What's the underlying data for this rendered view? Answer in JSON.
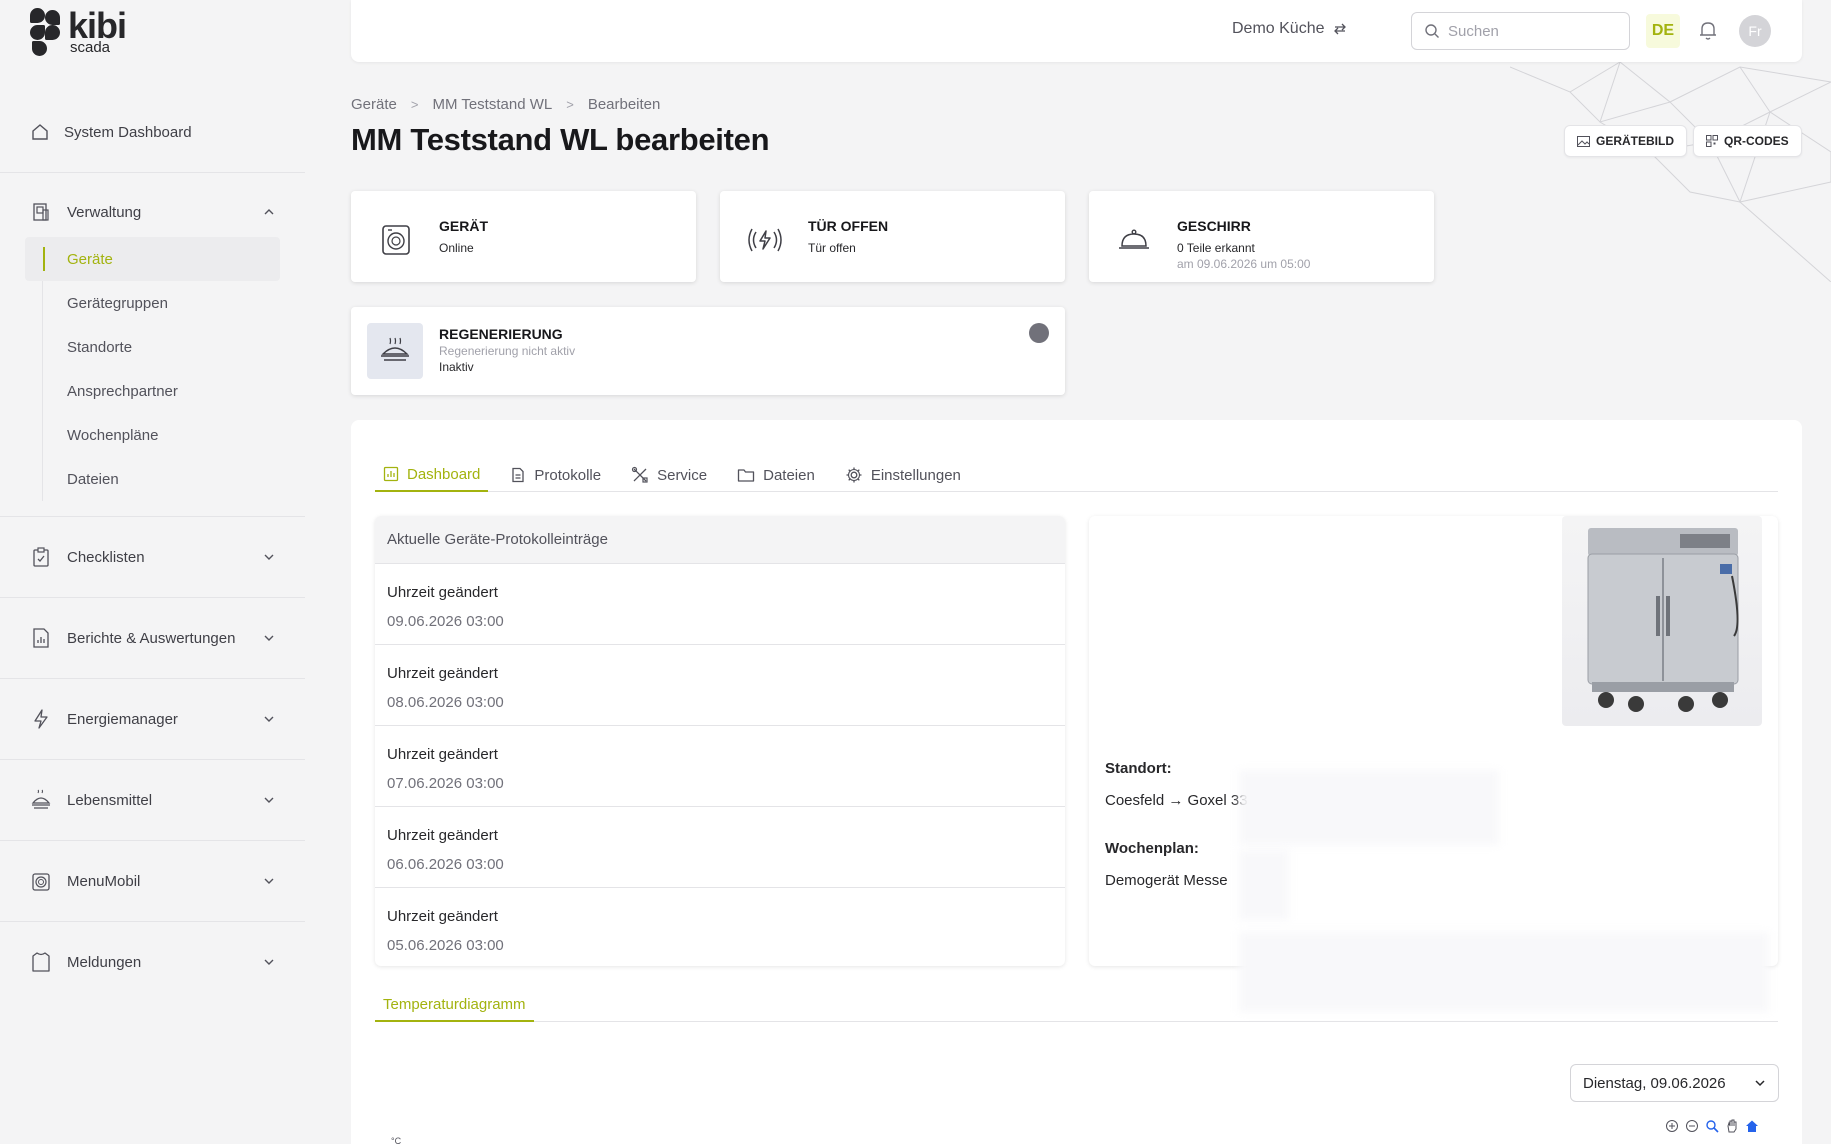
{
  "logo": {
    "brand": "kibi",
    "product": "scada"
  },
  "sidebar": {
    "dashboard_label": "System Dashboard",
    "verwaltung": {
      "label": "Verwaltung",
      "items": [
        {
          "label": "Geräte",
          "active": true
        },
        {
          "label": "Gerätegruppen"
        },
        {
          "label": "Standorte"
        },
        {
          "label": "Ansprechpartner"
        },
        {
          "label": "Wochenpläne"
        },
        {
          "label": "Dateien"
        }
      ]
    },
    "groups": [
      {
        "label": "Checklisten",
        "icon": "clipboard-icon"
      },
      {
        "label": "Berichte & Auswertungen",
        "icon": "report-icon"
      },
      {
        "label": "Energiemanager",
        "icon": "lightning-icon"
      },
      {
        "label": "Lebensmittel",
        "icon": "food-icon"
      },
      {
        "label": "MenuMobil",
        "icon": "device-icon"
      },
      {
        "label": "Meldungen",
        "icon": "shirt-icon"
      }
    ]
  },
  "topbar": {
    "kitchen": "Demo Küche",
    "search_placeholder": "Suchen",
    "language": "DE",
    "avatar_initials": "Fr"
  },
  "breadcrumb": [
    "Geräte",
    "MM Teststand WL",
    "Bearbeiten"
  ],
  "page_title": "MM Teststand WL bearbeiten",
  "actions": {
    "image_button": "GERÄTEBILD",
    "qr_button": "QR-CODES"
  },
  "status_cards": {
    "device": {
      "title": "GERÄT",
      "status": "Online"
    },
    "door": {
      "title": "TÜR OFFEN",
      "status": "Tür offen"
    },
    "dishes": {
      "title": "GESCHIRR",
      "status": "0 Teile erkannt",
      "date": "am 09.06.2026 um 05:00"
    },
    "regen": {
      "title": "REGENERIERUNG",
      "subtitle": "Regenerierung nicht aktiv",
      "status": "Inaktiv",
      "indicator_color": "#71717a"
    }
  },
  "tabs": [
    "Dashboard",
    "Protokolle",
    "Service",
    "Dateien",
    "Einstellungen"
  ],
  "log": {
    "heading": "Aktuelle Geräte-Protokolleinträge",
    "entries": [
      {
        "title": "Uhrzeit geändert",
        "date": "09.06.2026 03:00"
      },
      {
        "title": "Uhrzeit geändert",
        "date": "08.06.2026 03:00"
      },
      {
        "title": "Uhrzeit geändert",
        "date": "07.06.2026 03:00"
      },
      {
        "title": "Uhrzeit geändert",
        "date": "06.06.2026 03:00"
      },
      {
        "title": "Uhrzeit geändert",
        "date": "05.06.2026 03:00"
      }
    ]
  },
  "info": {
    "location_label": "Standort:",
    "location_value": "Coesfeld → Goxel 33",
    "schedule_label": "Wochenplan:",
    "schedule_value": "Demogerät Messe"
  },
  "chart_tab": "Temperaturdiagramm",
  "date_select": "Dienstag, 09.06.2026",
  "chart_y_label": "°C",
  "colors": {
    "accent": "#a3b30f",
    "text": "#27272a",
    "background": "#f4f4f5"
  }
}
